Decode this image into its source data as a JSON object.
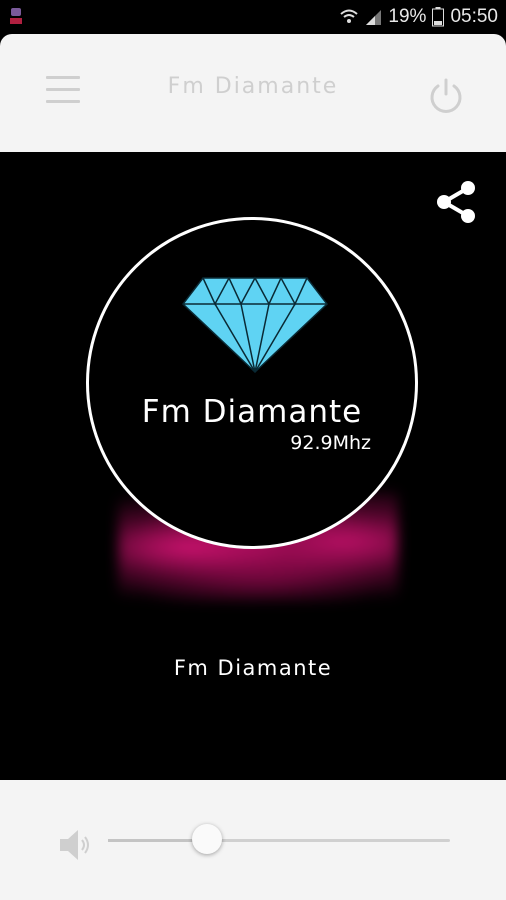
{
  "status_bar": {
    "battery_percent": "19%",
    "time": "05:50"
  },
  "header": {
    "title": "Fm Diamante"
  },
  "player": {
    "logo_name": "Fm Diamante",
    "logo_frequency": "92.9Mhz",
    "station_name": "Fm Diamante"
  },
  "volume": {
    "level": 0.29
  },
  "colors": {
    "diamond": "#5fd3f3",
    "glow": "#d8137a",
    "header_bg": "#f4f4f4"
  },
  "icons": [
    "menu-icon",
    "power-icon",
    "share-icon",
    "volume-icon",
    "diamond-logo"
  ]
}
